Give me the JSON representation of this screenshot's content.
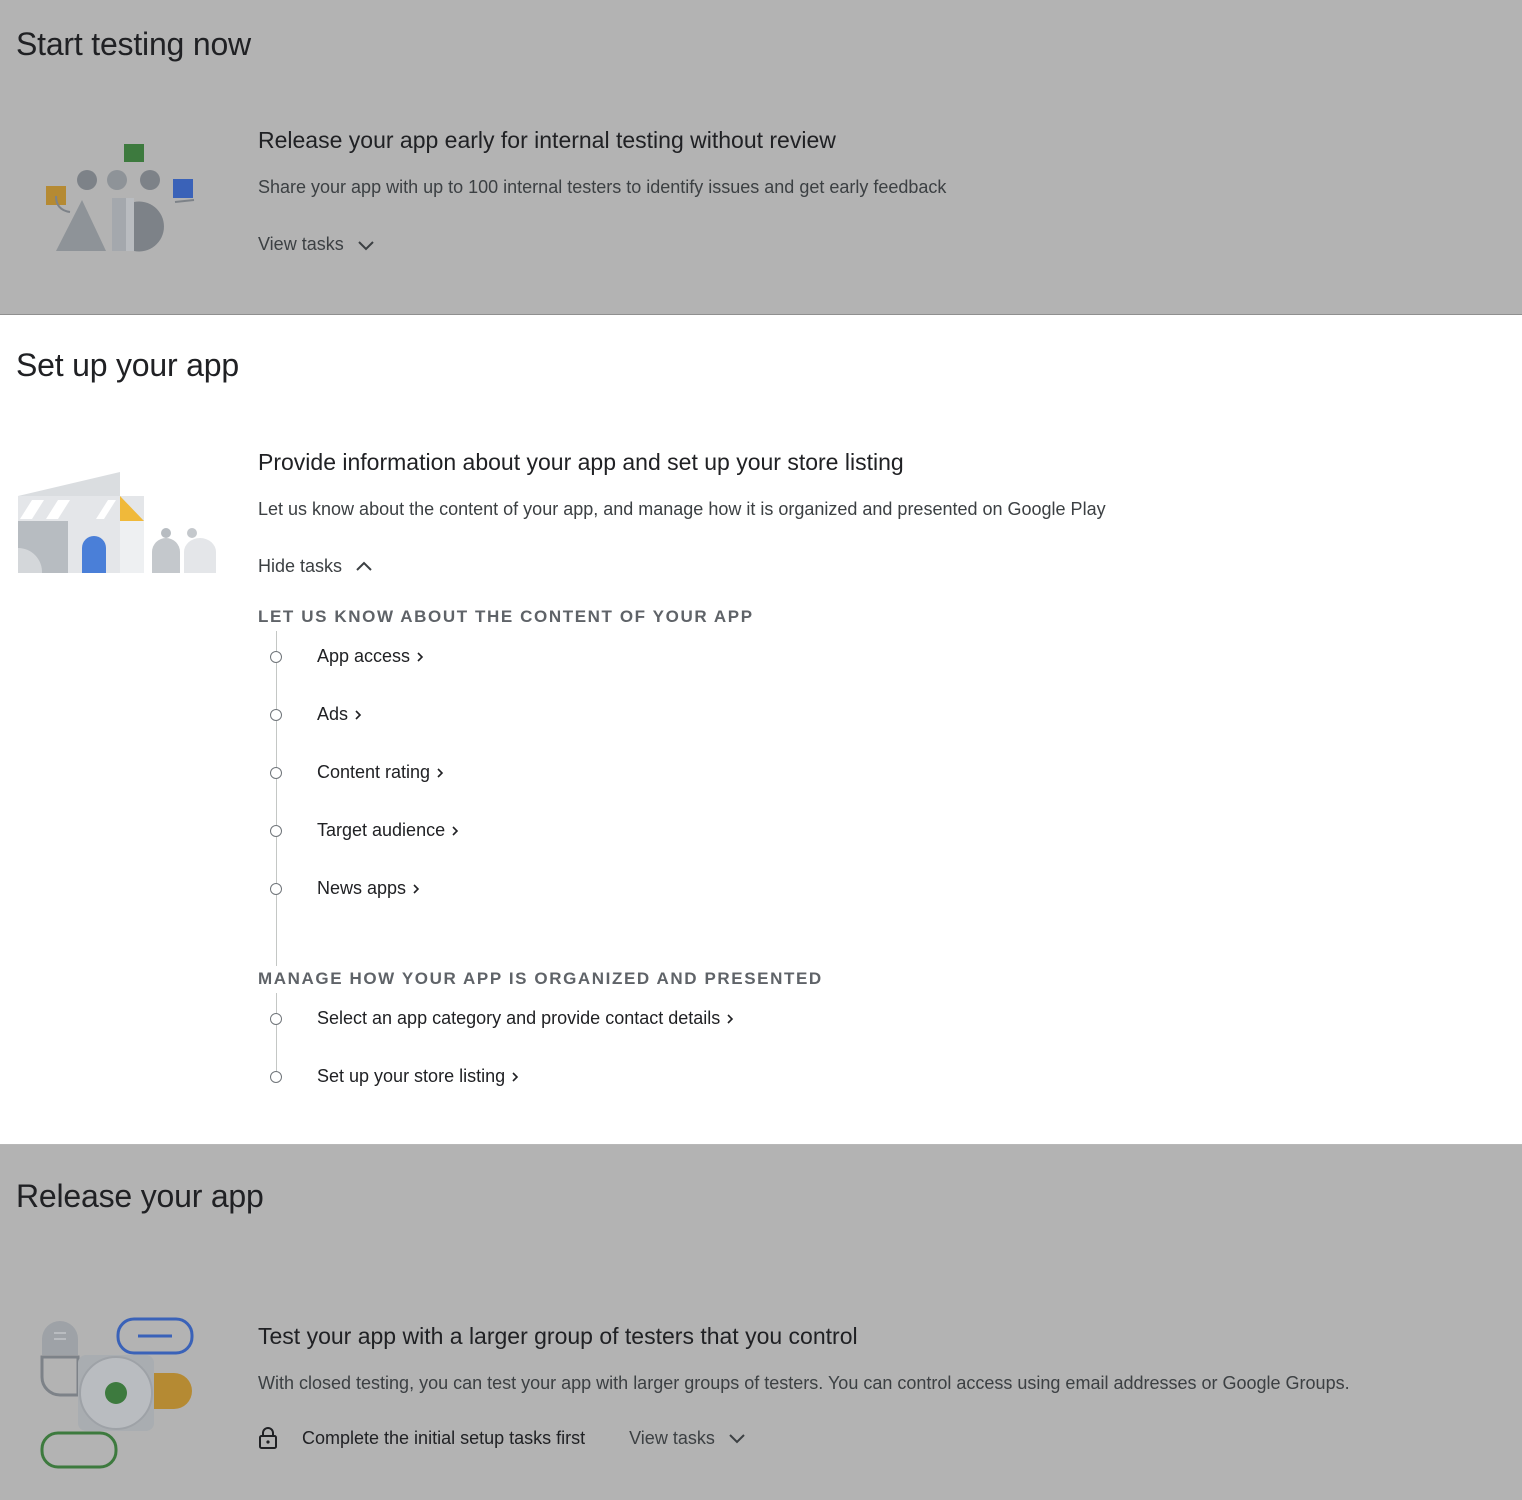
{
  "testing": {
    "title": "Start testing now",
    "card_title": "Release your app early for internal testing without review",
    "card_desc": "Share your app with up to 100 internal testers to identify issues and get early feedback",
    "toggle_label": "View tasks",
    "toggle_icon": "chevron-down-icon"
  },
  "setup": {
    "title": "Set up your app",
    "card_title": "Provide information about your app and set up your store listing",
    "card_desc": "Let us know about the content of your app, and manage how it is organized and presented on Google Play",
    "toggle_label": "Hide tasks",
    "toggle_icon": "chevron-up-icon",
    "groups": [
      {
        "heading": "Let us know about the content of your app",
        "tasks": [
          "App access",
          "Ads",
          "Content rating",
          "Target audience",
          "News apps"
        ]
      },
      {
        "heading": "Manage how your app is organized and presented",
        "tasks": [
          "Select an app category and provide contact details",
          "Set up your store listing"
        ]
      }
    ]
  },
  "release": {
    "title": "Release your app",
    "card_title": "Test your app with a larger group of testers that you control",
    "card_desc": "With closed testing, you can test your app with larger groups of testers. You can control access using email addresses or Google Groups.",
    "lock_message": "Complete the initial setup tasks first",
    "lock_icon": "lock-icon",
    "toggle_label": "View tasks",
    "toggle_icon": "chevron-down-icon"
  },
  "colors": {
    "dim_overlay": "#b3b3b3",
    "green": "#3d7a3e",
    "blue": "#3a62b8",
    "gold": "#b58a33",
    "gray_shape": "#7d8288"
  }
}
